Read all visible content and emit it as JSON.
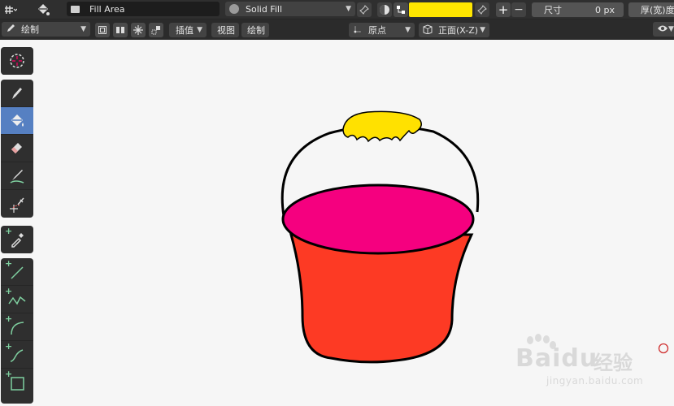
{
  "header": {
    "fill_area_label": "Fill Area",
    "fill_mode": "Solid Fill",
    "fill_color": "#ffe600",
    "size_label": "尺寸",
    "size_value": "0 px",
    "thickness_label": "厚(宽)度"
  },
  "toolbar2": {
    "mode_label": "绘制",
    "interpolate_label": "插值",
    "view_label": "视图",
    "draw_label": "绘制",
    "origin_label": "原点",
    "view_axis_label": "正面(X-Z)"
  },
  "tools": {
    "icons": [
      "cursor-icon",
      "draw-icon",
      "fill-icon",
      "erase-icon",
      "tint-icon",
      "cutter-icon",
      "eyedropper-icon",
      "line-icon",
      "polyline-icon",
      "arc-icon",
      "curve-icon",
      "box-icon"
    ]
  },
  "colors": {
    "handle": "#ffe100",
    "bucket_top": "#f5007f",
    "bucket_body": "#fd3a24",
    "accent": "#4772b3"
  },
  "watermark": {
    "brand": "Baidu",
    "cn": "经验",
    "url": "jingyan.baidu.com"
  }
}
